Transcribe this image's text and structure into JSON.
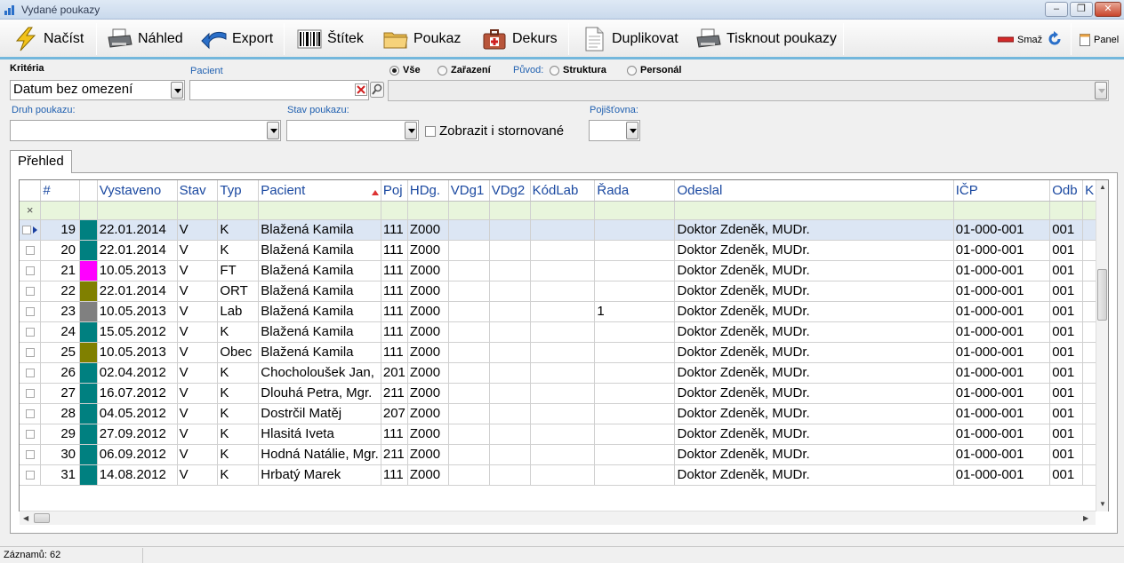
{
  "window": {
    "title": "Vydané poukazy",
    "min": "‒",
    "max": "❐",
    "close": "✕"
  },
  "toolbar": {
    "load": "Načíst",
    "preview": "Náhled",
    "export": "Export",
    "label": "Štítek",
    "voucher": "Poukaz",
    "dekurs": "Dekurs",
    "duplicate": "Duplikovat",
    "print_vouchers": "Tisknout poukazy",
    "delete": "Smaž",
    "panel": "Panel"
  },
  "criteria": {
    "title": "Kritéria",
    "date_filter": "Datum bez omezení",
    "patient_label": "Pacient",
    "patient_value": "",
    "radio_all": "Vše",
    "radio_assigned": "Zařazení",
    "origin_label": "Původ:",
    "radio_structure": "Struktura",
    "radio_personnel": "Personál",
    "voucher_type_label": "Druh poukazu:",
    "voucher_state_label": "Stav poukazu:",
    "show_cancelled": "Zobrazit i stornované",
    "insurer_label": "Pojišťovna:"
  },
  "tabs": {
    "overview": "Přehled"
  },
  "grid": {
    "filter_clear": "×",
    "columns": [
      "#",
      "Vystaveno",
      "Stav",
      "Typ",
      "Pacient",
      "Poj",
      "HDg.",
      "VDg1",
      "VDg2",
      "KódLab",
      "Řada",
      "Odeslal",
      "IČP",
      "Odb",
      "K"
    ],
    "rows": [
      {
        "n": "19",
        "color": "#008080",
        "date": "22.01.2014",
        "state": "V",
        "type": "K",
        "patient": "Blažená  Kamila",
        "poj": "111",
        "hdg": "Z000",
        "rada": "",
        "sent": "Doktor Zdeněk, MUDr.",
        "icp": "01-000-001",
        "odb": "001"
      },
      {
        "n": "20",
        "color": "#008080",
        "date": "22.01.2014",
        "state": "V",
        "type": "K",
        "patient": "Blažená  Kamila",
        "poj": "111",
        "hdg": "Z000",
        "rada": "",
        "sent": "Doktor Zdeněk, MUDr.",
        "icp": "01-000-001",
        "odb": "001"
      },
      {
        "n": "21",
        "color": "#ff00ff",
        "date": "10.05.2013",
        "state": "V",
        "type": "FT",
        "patient": "Blažená  Kamila",
        "poj": "111",
        "hdg": "Z000",
        "rada": "",
        "sent": "Doktor Zdeněk, MUDr.",
        "icp": "01-000-001",
        "odb": "001"
      },
      {
        "n": "22",
        "color": "#808000",
        "date": "22.01.2014",
        "state": "V",
        "type": "ORT",
        "patient": "Blažená  Kamila",
        "poj": "111",
        "hdg": "Z000",
        "rada": "",
        "sent": "Doktor Zdeněk, MUDr.",
        "icp": "01-000-001",
        "odb": "001"
      },
      {
        "n": "23",
        "color": "#808080",
        "date": "10.05.2013",
        "state": "V",
        "type": "Lab",
        "patient": "Blažená  Kamila",
        "poj": "111",
        "hdg": "Z000",
        "rada": "1",
        "sent": "Doktor Zdeněk, MUDr.",
        "icp": "01-000-001",
        "odb": "001"
      },
      {
        "n": "24",
        "color": "#008080",
        "date": "15.05.2012",
        "state": "V",
        "type": "K",
        "patient": "Blažená  Kamila",
        "poj": "111",
        "hdg": "Z000",
        "rada": "",
        "sent": "Doktor Zdeněk, MUDr.",
        "icp": "01-000-001",
        "odb": "001"
      },
      {
        "n": "25",
        "color": "#808000",
        "date": "10.05.2013",
        "state": "V",
        "type": "Obec",
        "patient": "Blažená  Kamila",
        "poj": "111",
        "hdg": "Z000",
        "rada": "",
        "sent": "Doktor Zdeněk, MUDr.",
        "icp": "01-000-001",
        "odb": "001"
      },
      {
        "n": "26",
        "color": "#008080",
        "date": "02.04.2012",
        "state": "V",
        "type": "K",
        "patient": "Chocholoušek Jan,",
        "poj": "201",
        "hdg": "Z000",
        "rada": "",
        "sent": "Doktor Zdeněk, MUDr.",
        "icp": "01-000-001",
        "odb": "001"
      },
      {
        "n": "27",
        "color": "#008080",
        "date": "16.07.2012",
        "state": "V",
        "type": "K",
        "patient": "Dlouhá  Petra, Mgr.",
        "poj": "211",
        "hdg": "Z000",
        "rada": "",
        "sent": "Doktor Zdeněk, MUDr.",
        "icp": "01-000-001",
        "odb": "001"
      },
      {
        "n": "28",
        "color": "#008080",
        "date": "04.05.2012",
        "state": "V",
        "type": "K",
        "patient": "Dostrčil Matěj",
        "poj": "207",
        "hdg": "Z000",
        "rada": "",
        "sent": "Doktor Zdeněk, MUDr.",
        "icp": "01-000-001",
        "odb": "001"
      },
      {
        "n": "29",
        "color": "#008080",
        "date": "27.09.2012",
        "state": "V",
        "type": "K",
        "patient": "Hlasitá  Iveta",
        "poj": "111",
        "hdg": "Z000",
        "rada": "",
        "sent": "Doktor Zdeněk, MUDr.",
        "icp": "01-000-001",
        "odb": "001"
      },
      {
        "n": "30",
        "color": "#008080",
        "date": "06.09.2012",
        "state": "V",
        "type": "K",
        "patient": "Hodná Natálie, Mgr.",
        "poj": "211",
        "hdg": "Z000",
        "rada": "",
        "sent": "Doktor Zdeněk, MUDr.",
        "icp": "01-000-001",
        "odb": "001"
      },
      {
        "n": "31",
        "color": "#008080",
        "date": "14.08.2012",
        "state": "V",
        "type": "K",
        "patient": "Hrbatý Marek",
        "poj": "111",
        "hdg": "Z000",
        "rada": "",
        "sent": "Doktor Zdeněk, MUDr.",
        "icp": "01-000-001",
        "odb": "001"
      }
    ]
  },
  "status": {
    "records": "Záznamů: 62"
  }
}
